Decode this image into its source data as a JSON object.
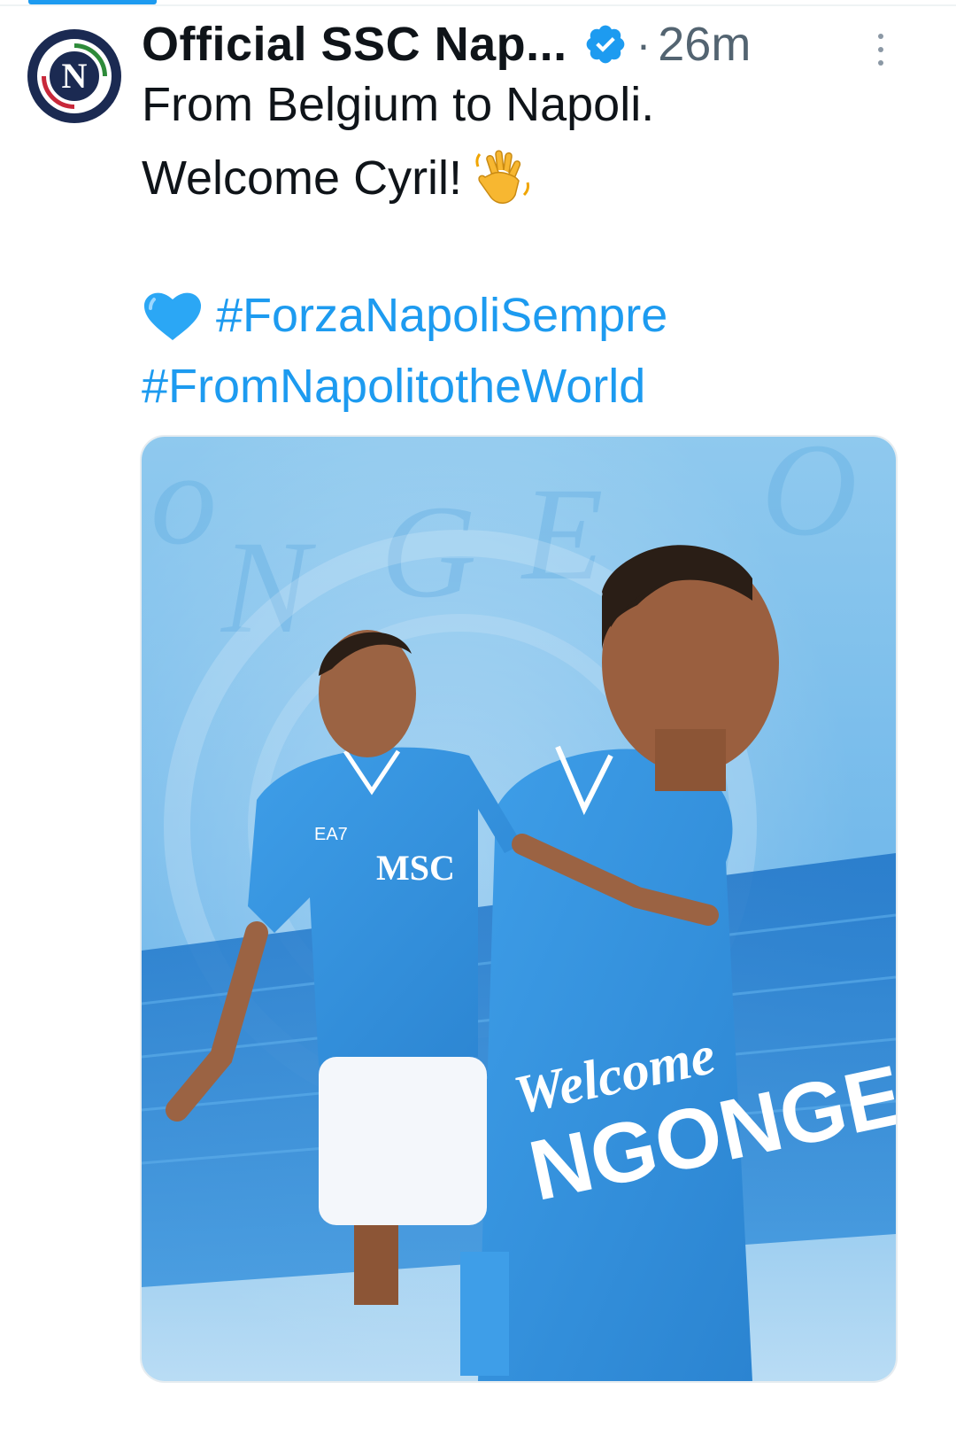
{
  "tweet": {
    "display_name": "Official SSC Nap...",
    "avatar_letter": "N",
    "timestamp": "26m",
    "separator": "·",
    "text_line1": "From Belgium to Napoli.",
    "text_line2": "Welcome Cyril!",
    "hashtag1": "#ForzaNapoliSempre",
    "hashtag2": "#FromNapolitotheWorld"
  },
  "media": {
    "welcome_script": "Welcome",
    "player_name": "NGONGE",
    "sponsor_text": "MSC",
    "kit_brand": "EA7"
  },
  "icons": {
    "verified": "verified-badge-icon",
    "more": "more-vertical-icon",
    "wave": "waving-hand-emoji",
    "heart": "blue-heart-emoji"
  },
  "colors": {
    "accent": "#1d9bf0",
    "text": "#0f1419",
    "muted": "#536471",
    "media_blue": "#2f8fd6"
  }
}
